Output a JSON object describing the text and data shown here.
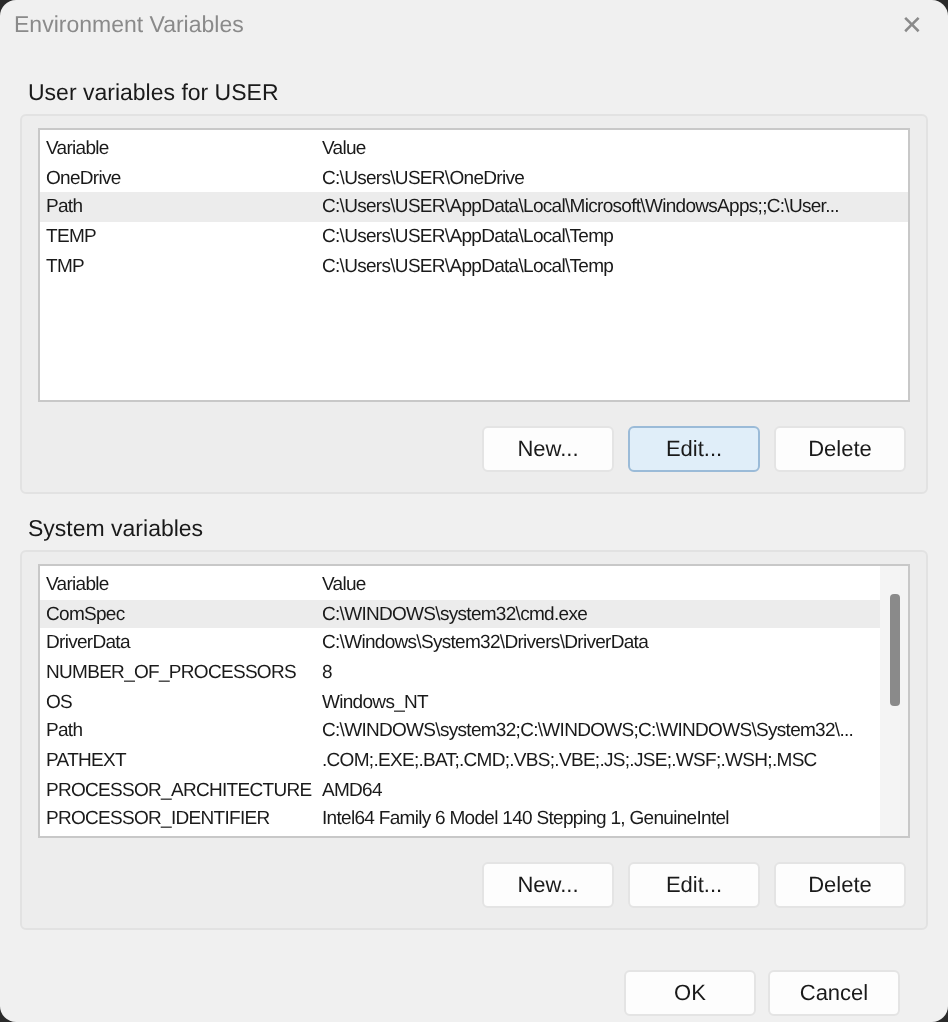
{
  "window": {
    "title": "Environment Variables",
    "close": "✕"
  },
  "user_variables": {
    "title": "User variables for USER",
    "columns": [
      "Variable",
      "Value"
    ],
    "rows": [
      {
        "variable": "OneDrive",
        "value": "C:\\Users\\USER\\OneDrive",
        "selected": false
      },
      {
        "variable": "Path",
        "value": "C:\\Users\\USER\\AppData\\Local\\Microsoft\\WindowsApps;;C:\\User...",
        "selected": true
      },
      {
        "variable": "TEMP",
        "value": "C:\\Users\\USER\\AppData\\Local\\Temp",
        "selected": false
      },
      {
        "variable": "TMP",
        "value": "C:\\Users\\USER\\AppData\\Local\\Temp",
        "selected": false
      }
    ],
    "buttons": [
      {
        "label": "New...",
        "focused": false
      },
      {
        "label": "Edit...",
        "focused": true
      },
      {
        "label": "Delete",
        "focused": false
      }
    ]
  },
  "system_variables": {
    "title": "System variables",
    "columns": [
      "Variable",
      "Value"
    ],
    "rows": [
      {
        "variable": "ComSpec",
        "value": "C:\\WINDOWS\\system32\\cmd.exe",
        "selected": true
      },
      {
        "variable": "DriverData",
        "value": "C:\\Windows\\System32\\Drivers\\DriverData",
        "selected": false
      },
      {
        "variable": "NUMBER_OF_PROCESSORS",
        "value": "8",
        "selected": false
      },
      {
        "variable": "OS",
        "value": "Windows_NT",
        "selected": false
      },
      {
        "variable": "Path",
        "value": "C:\\WINDOWS\\system32;C:\\WINDOWS;C:\\WINDOWS\\System32\\...",
        "selected": false
      },
      {
        "variable": "PATHEXT",
        "value": ".COM;.EXE;.BAT;.CMD;.VBS;.VBE;.JS;.JSE;.WSF;.WSH;.MSC",
        "selected": false
      },
      {
        "variable": "PROCESSOR_ARCHITECTURE",
        "value": "AMD64",
        "selected": false
      },
      {
        "variable": "PROCESSOR_IDENTIFIER",
        "value": "Intel64 Family 6 Model 140 Stepping 1, GenuineIntel",
        "selected": false
      }
    ],
    "buttons": [
      {
        "label": "New...",
        "focused": false
      },
      {
        "label": "Edit...",
        "focused": false
      },
      {
        "label": "Delete",
        "focused": false
      }
    ]
  },
  "dialog_buttons": [
    {
      "label": "OK",
      "focused": false
    },
    {
      "label": "Cancel",
      "focused": false
    }
  ]
}
